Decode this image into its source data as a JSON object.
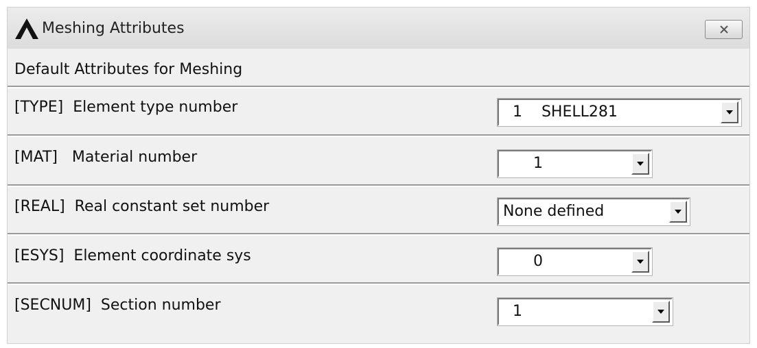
{
  "window": {
    "title": "Meshing Attributes",
    "header": "Default Attributes for Meshing"
  },
  "rows": [
    {
      "label": "[TYPE]  Element type number",
      "value": "1    SHELL281"
    },
    {
      "label": "[MAT]   Material number",
      "value": "1"
    },
    {
      "label": "[REAL]  Real constant set number",
      "value": "None defined"
    },
    {
      "label": "[ESYS]  Element coordinate sys",
      "value": "0"
    },
    {
      "label": "[SECNUM]  Section number",
      "value": "1"
    }
  ],
  "icons": {
    "app": "ansys-logo-icon",
    "close": "close-icon",
    "dropdown": "chevron-down-icon"
  },
  "colors": {
    "window_bg": "#f0f0f0",
    "divider": "#9a9a9a",
    "field_bg": "#ffffff"
  }
}
